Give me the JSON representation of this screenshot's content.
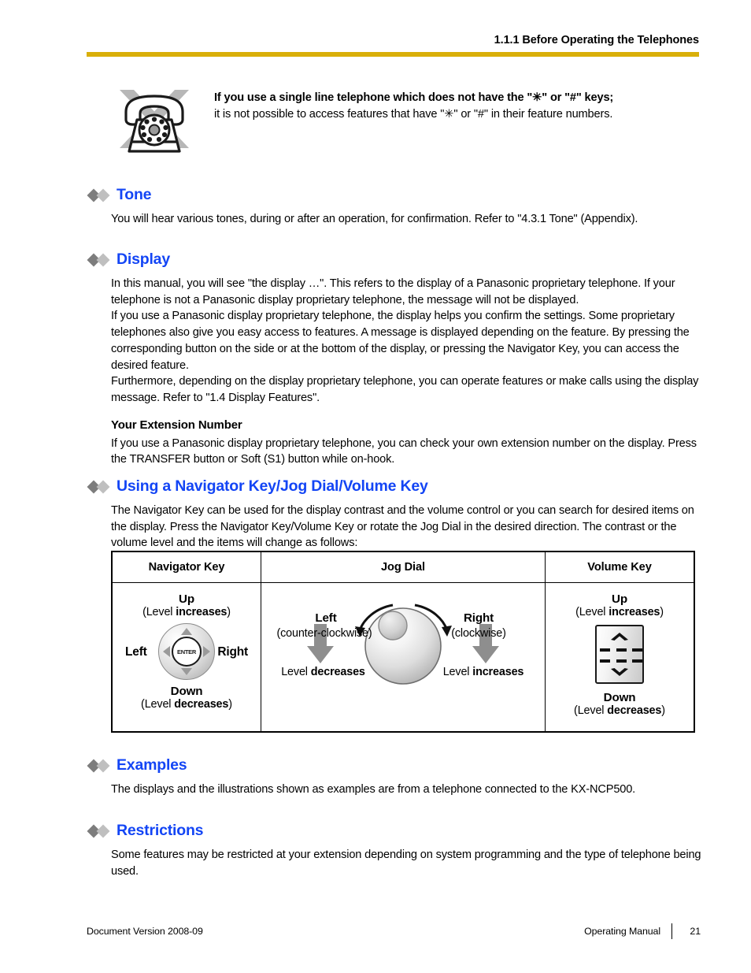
{
  "header": {
    "title": "1.1.1 Before Operating the Telephones",
    "rule_color": "#d9af09"
  },
  "note": {
    "icon": "rotary-telephone-crossed-out-icon",
    "line1": "If you use a single line telephone which does not have the \"✳\" or \"#\" keys;",
    "line2": "it is not possible to access features that have \"✳\" or \"#\" in their feature numbers."
  },
  "sections": [
    {
      "title": "Tone",
      "body": [
        "You will hear various tones, during or after an operation, for confirmation. Refer to \"4.3.1  Tone\" (Appendix)."
      ]
    },
    {
      "title": "Display",
      "body": [
        "In this manual, you will see \"the display …\". This refers to the display of a Panasonic proprietary telephone. If your telephone is not a Panasonic display proprietary telephone, the message will not be displayed.",
        "If you use a Panasonic display proprietary telephone, the display helps you confirm the settings. Some proprietary telephones also give you easy access to features. A message is displayed depending on the feature. By pressing the corresponding button on the side or at the bottom of the display, or pressing the Navigator Key, you can access the desired feature.",
        "Furthermore, depending on the display proprietary telephone, you can operate features or make calls using the display message. Refer to \"1.4  Display Features\"."
      ],
      "subhead": "Your Extension Number",
      "subbody": [
        "If you use a Panasonic display proprietary telephone, you can check your own extension number on the display. Press the TRANSFER button or Soft (S1) button while on-hook."
      ]
    },
    {
      "title": "Using a Navigator Key/Jog Dial/Volume Key",
      "body": [
        "The Navigator Key can be used for the display contrast and the volume control or you can search for desired items on the display. Press the Navigator Key/Volume Key or rotate the Jog Dial in the desired direction. The contrast or the volume level and the items will change as follows:"
      ]
    },
    {
      "title": "Examples",
      "body": [
        "The displays and the illustrations shown as examples are from a telephone connected to the KX-NCP500."
      ]
    },
    {
      "title": "Restrictions",
      "body": [
        "Some features may be restricted at your extension depending on system programming and the type of telephone being used."
      ]
    }
  ],
  "table": {
    "headers": [
      "Navigator Key",
      "Jog Dial",
      "Volume Key"
    ],
    "navigator_key": {
      "up_label": "Up",
      "up_sub_pre": "(Level ",
      "up_sub_bold": "increases",
      "up_sub_post": ")",
      "left_label": "Left",
      "right_label": "Right",
      "center_label": "ENTER",
      "down_label": "Down",
      "down_sub_pre": "(Level ",
      "down_sub_bold": "decreases",
      "down_sub_post": ")"
    },
    "jog_dial": {
      "left_label": "Left",
      "left_sub": "(counter-clockwise)",
      "left_result_pre": "Level ",
      "left_result_bold": "decreases",
      "right_label": "Right",
      "right_sub": "(clockwise)",
      "right_result_pre": "Level ",
      "right_result_bold": "increases"
    },
    "volume_key": {
      "up_label": "Up",
      "up_sub_pre": "(Level ",
      "up_sub_bold": "increases",
      "up_sub_post": ")",
      "down_label": "Down",
      "down_sub_pre": "(Level ",
      "down_sub_bold": "decreases",
      "down_sub_post": ")"
    }
  },
  "footer": {
    "left": "Document Version  2008-09",
    "manual": "Operating Manual",
    "page_number": "21"
  }
}
